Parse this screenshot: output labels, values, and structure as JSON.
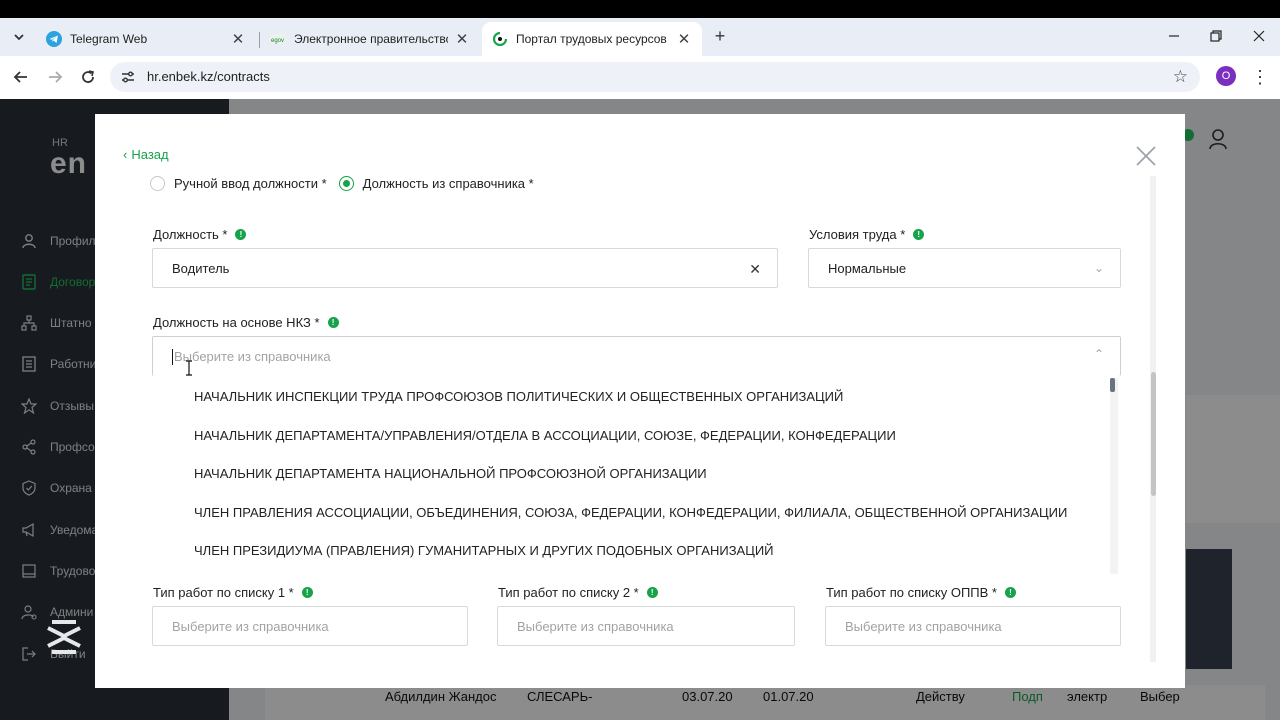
{
  "browser": {
    "tabs": [
      {
        "title": "Telegram Web",
        "active": false
      },
      {
        "title": "Электронное правительство Р",
        "active": false
      },
      {
        "title": "Портал трудовых ресурсов",
        "active": true
      }
    ],
    "url": "hr.enbek.kz/contracts",
    "profile_initial": "O"
  },
  "sidebar": {
    "logo_small": "HR",
    "logo_main": "en",
    "items": [
      {
        "label": "Профил",
        "icon": "user-icon"
      },
      {
        "label": "Договор",
        "icon": "document-icon",
        "active": true
      },
      {
        "label": "Штатно",
        "icon": "org-chart-icon"
      },
      {
        "label": "Работни",
        "icon": "list-icon"
      },
      {
        "label": "Отзывы",
        "icon": "star-icon"
      },
      {
        "label": "Профсо",
        "icon": "share-icon"
      },
      {
        "label": "Охрана",
        "icon": "shield-icon"
      },
      {
        "label": "Уведома",
        "icon": "megaphone-icon"
      },
      {
        "label": "Трудово",
        "icon": "book-icon"
      },
      {
        "label": "Админи",
        "icon": "admin-icon"
      },
      {
        "label": "Выйти",
        "icon": "logout-icon"
      }
    ]
  },
  "background_row": {
    "name": "Абдилдин Жандос",
    "position": "СЛЕСАРЬ-",
    "date1": "03.07.20",
    "date2": "01.07.20",
    "status": "Действу",
    "badge": "Подп",
    "type": "электр",
    "action": "Выбер"
  },
  "modal": {
    "back_label": "Назад",
    "radio_manual": "Ручной ввод должности *",
    "radio_catalog": "Должность из справочника *",
    "position_label": "Должность *",
    "position_value": "Водитель",
    "conditions_label": "Условия труда *",
    "conditions_value": "Нормальные",
    "nkz_label": "Должность на основе НКЗ *",
    "nkz_placeholder": "Выберите из справочника",
    "dropdown_items": [
      "НАЧАЛЬНИК ИНСПЕКЦИИ ТРУДА ПРОФСОЮЗОВ ПОЛИТИЧЕСКИХ И ОБЩЕСТВЕННЫХ ОРГАНИЗАЦИЙ",
      "НАЧАЛЬНИК ДЕПАРТАМЕНТА/УПРАВЛЕНИЯ/ОТДЕЛА В АССОЦИАЦИИ, СОЮЗЕ, ФЕДЕРАЦИИ, КОНФЕДЕРАЦИИ",
      "НАЧАЛЬНИК ДЕПАРТАМЕНТА НАЦИОНАЛЬНОЙ ПРОФСОЮЗНОЙ ОРГАНИЗАЦИИ",
      "ЧЛЕН ПРАВЛЕНИЯ АССОЦИАЦИИ, ОБЪЕДИНЕНИЯ, СОЮЗА, ФЕДЕРАЦИИ, КОНФЕДЕРАЦИИ, ФИЛИАЛА, ОБЩЕСТВЕННОЙ ОРГАНИЗАЦИИ",
      "ЧЛЕН ПРЕЗИДИУМА (ПРАВЛЕНИЯ) ГУМАНИТАРНЫХ И ДРУГИХ ПОДОБНЫХ ОРГАНИЗАЦИЙ"
    ],
    "list1_label": "Тип работ по списку 1 *",
    "list2_label": "Тип работ по списку 2 *",
    "oppv_label": "Тип работ по списку ОППВ *",
    "select_placeholder": "Выберите из справочника"
  },
  "colors": {
    "accent": "#16a34a",
    "sidebar_bg": "#2b3138",
    "chrome_bg": "#e9eef6"
  }
}
